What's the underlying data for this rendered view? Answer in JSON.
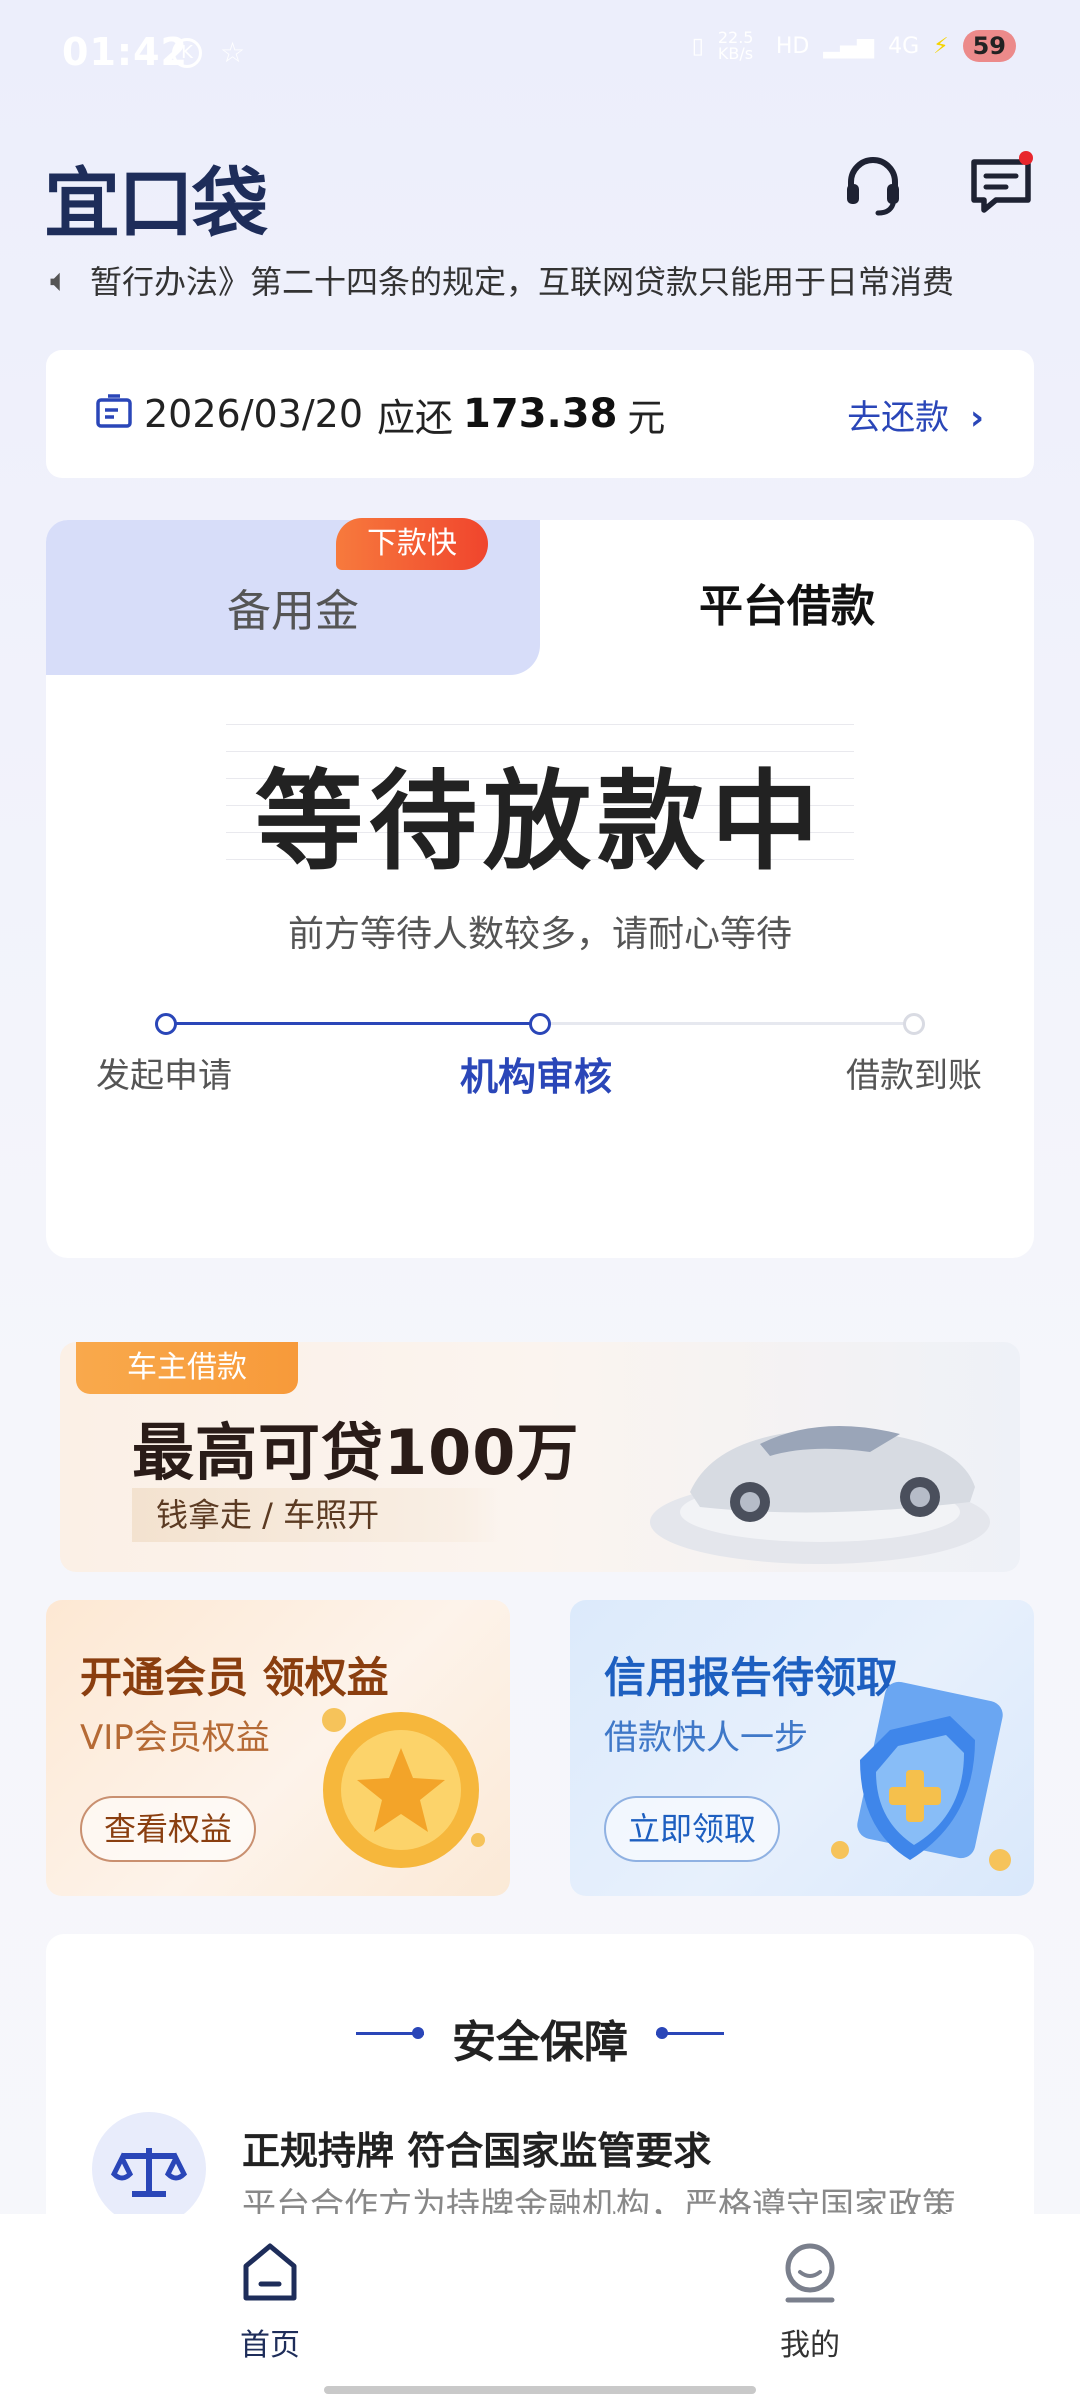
{
  "status_bar": {
    "time": "01:42",
    "network_speed": "22.5 KB/s",
    "signal": "4G",
    "battery": "59"
  },
  "header": {
    "logo_text": "宜口袋",
    "support_icon": "headset-icon",
    "message_icon": "message-icon"
  },
  "notice": {
    "text": "暂行办法》第二十四条的规定，互联网贷款只能用于日常消费"
  },
  "repay": {
    "date": "2026/03/20",
    "label_due": "应还",
    "amount": "173.38",
    "unit": "元",
    "action": "去还款"
  },
  "tabs": [
    {
      "label": "备用金",
      "badge": "下款快",
      "active": false
    },
    {
      "label": "平台借款",
      "active": true
    }
  ],
  "loan_status": {
    "title": "等待放款中",
    "subtitle": "前方等待人数较多，请耐心等待",
    "steps": [
      {
        "label": "发起申请",
        "state": "done"
      },
      {
        "label": "机构审核",
        "state": "current"
      },
      {
        "label": "借款到账",
        "state": "pending"
      }
    ]
  },
  "car_banner": {
    "tag": "车主借款",
    "title": "最高可贷100万",
    "subtitle": "钱拿走 / 车照开"
  },
  "vip_banner": {
    "title": "开通会员 领权益",
    "subtitle": "VIP会员权益",
    "button": "查看权益"
  },
  "credit_banner": {
    "title": "信用报告待领取",
    "subtitle": "借款快人一步",
    "button": "立即领取"
  },
  "security": {
    "title": "安全保障",
    "items": [
      {
        "heading": "正规持牌 符合国家监管要求",
        "text": "平台合作方为持牌金融机构，严格遵守国家政策"
      }
    ]
  },
  "nav": {
    "home": "首页",
    "mine": "我的"
  },
  "colors": {
    "accent": "#2a46b8",
    "title_dark": "#1e2d5a",
    "badge": "#f0452d",
    "vip_text": "#8a3e0f",
    "credit_text": "#1d5fc0"
  }
}
